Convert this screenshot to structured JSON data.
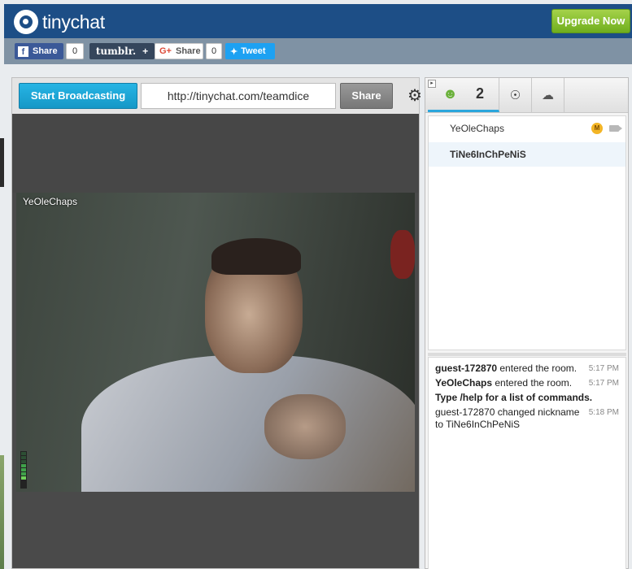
{
  "header": {
    "logo_text": "tinychat",
    "upgrade_label": "Upgrade Now"
  },
  "sharebar": {
    "facebook_label": "Share",
    "facebook_count": "0",
    "tumblr_label": "tumblr.",
    "tumblr_plus": "+",
    "gplus_label": "Share",
    "gplus_count": "0",
    "tweet_label": "Tweet"
  },
  "toolbar": {
    "start_label": "Start Broadcasting",
    "room_url": "http://tinychat.com/teamdice",
    "share_label": "Share"
  },
  "video": {
    "broadcaster": "YeOleChaps"
  },
  "tabs": {
    "user_count": "2"
  },
  "users": [
    {
      "name": "YeOleChaps",
      "badge": "M"
    },
    {
      "name": "TiNe6InChPeNiS"
    }
  ],
  "chat": [
    {
      "user": "guest-172870",
      "text": " entered the room.",
      "time": "5:17 PM",
      "user_bold": true
    },
    {
      "user": "YeOleChaps",
      "text": " entered the room.",
      "time": "5:17 PM",
      "user_bold": true
    },
    {
      "system": "Type /help for a list of commands."
    },
    {
      "user": "guest-172870",
      "text": " changed nickname to TiNe6InChPeNiS",
      "time": "5:18 PM",
      "user_bold": false
    }
  ]
}
